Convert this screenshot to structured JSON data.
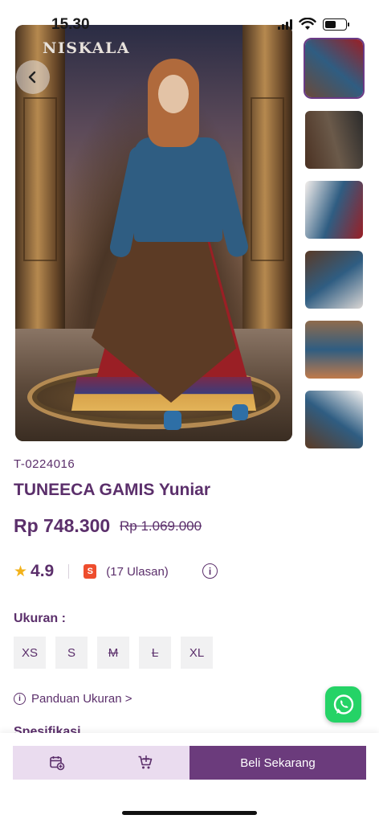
{
  "status_bar": {
    "time": "15.30",
    "battery_level": 0.55
  },
  "gallery": {
    "brand_logo": "NISKALA",
    "thumbnails": [
      {
        "name": "thumb-full-look",
        "active": true,
        "colors": [
          "#6a4a3a",
          "#2f5d82",
          "#9a1f25"
        ]
      },
      {
        "name": "thumb-vest-detail",
        "active": false,
        "colors": [
          "#4b3122",
          "#6b5a4a",
          "#2b2b2b"
        ]
      },
      {
        "name": "thumb-sleeve-detail",
        "active": false,
        "colors": [
          "#f4efec",
          "#2f5d82",
          "#9a1f25"
        ]
      },
      {
        "name": "thumb-skirt-detail",
        "active": false,
        "colors": [
          "#5a3a27",
          "#2f5d82",
          "#dad6d4"
        ]
      },
      {
        "name": "thumb-chain-detail",
        "active": false,
        "colors": [
          "#8f6b4c",
          "#2f5d82",
          "#c07a4a"
        ]
      },
      {
        "name": "thumb-back-view",
        "active": false,
        "colors": [
          "#f4f2f1",
          "#2f5d82",
          "#5c3b25"
        ]
      }
    ]
  },
  "product": {
    "sku": "T-0224016",
    "name": "TUNEECA GAMIS Yuniar",
    "price": "Rp 748.300",
    "original_price": "Rp 1.069.000",
    "rating": "4.9",
    "reviews": "(17 Ulasan)"
  },
  "size_section": {
    "label": "Ukuran :",
    "options": [
      {
        "label": "XS",
        "available": true
      },
      {
        "label": "S",
        "available": true
      },
      {
        "label": "M",
        "available": false
      },
      {
        "label": "L",
        "available": false
      },
      {
        "label": "XL",
        "available": true
      }
    ],
    "guide": "Panduan Ukuran >"
  },
  "next_section_peek": "Spesifikasi",
  "actions": {
    "buy_now": "Beli Sekarang"
  },
  "colors": {
    "brand_purple": "#5b2f6b",
    "primary_button": "#6b3b7c",
    "secondary_button": "#eadcef",
    "whatsapp_green": "#25d366",
    "star": "#f2b21a",
    "shopee_orange": "#ee4d2d"
  }
}
